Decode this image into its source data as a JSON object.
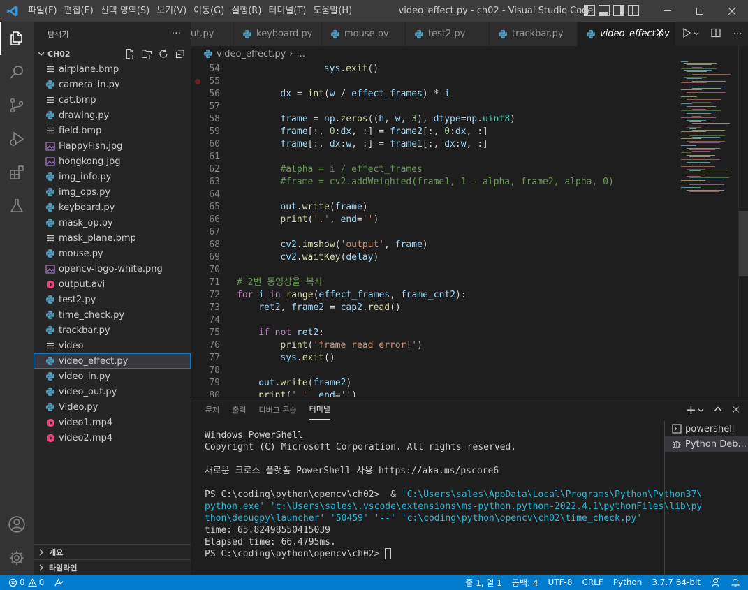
{
  "titlebar": {
    "menus": [
      "파일(F)",
      "편집(E)",
      "선택 영역(S)",
      "보기(V)",
      "이동(G)",
      "실행(R)",
      "터미널(T)",
      "도움말(H)"
    ],
    "window_title": "video_effect.py - ch02 - Visual Studio Code"
  },
  "sidebar": {
    "header": "탐색기",
    "folder": "CH02",
    "files": [
      {
        "name": "airplane.bmp",
        "icon": "lines-icon"
      },
      {
        "name": "camera_in.py",
        "icon": "python-icon"
      },
      {
        "name": "cat.bmp",
        "icon": "lines-icon"
      },
      {
        "name": "drawing.py",
        "icon": "python-icon"
      },
      {
        "name": "field.bmp",
        "icon": "lines-icon"
      },
      {
        "name": "HappyFish.jpg",
        "icon": "image-icon"
      },
      {
        "name": "hongkong.jpg",
        "icon": "image-icon"
      },
      {
        "name": "img_info.py",
        "icon": "python-icon"
      },
      {
        "name": "img_ops.py",
        "icon": "python-icon"
      },
      {
        "name": "keyboard.py",
        "icon": "python-icon"
      },
      {
        "name": "mask_op.py",
        "icon": "python-icon"
      },
      {
        "name": "mask_plane.bmp",
        "icon": "lines-icon"
      },
      {
        "name": "mouse.py",
        "icon": "python-icon"
      },
      {
        "name": "opencv-logo-white.png",
        "icon": "image-icon"
      },
      {
        "name": "output.avi",
        "icon": "video-icon"
      },
      {
        "name": "test2.py",
        "icon": "python-icon"
      },
      {
        "name": "time_check.py",
        "icon": "python-icon"
      },
      {
        "name": "trackbar.py",
        "icon": "python-icon"
      },
      {
        "name": "video",
        "icon": "lines-icon"
      },
      {
        "name": "video_effect.py",
        "icon": "python-icon"
      },
      {
        "name": "video_in.py",
        "icon": "python-icon"
      },
      {
        "name": "video_out.py",
        "icon": "python-icon"
      },
      {
        "name": "Video.py",
        "icon": "python-icon"
      },
      {
        "name": "video1.mp4",
        "icon": "video-icon"
      },
      {
        "name": "video2.mp4",
        "icon": "video-icon"
      }
    ],
    "outline_label": "개요",
    "timeline_label": "타임라인"
  },
  "tabs": [
    {
      "label": "ut.py"
    },
    {
      "label": "keyboard.py"
    },
    {
      "label": "mouse.py"
    },
    {
      "label": "test2.py"
    },
    {
      "label": "trackbar.py"
    },
    {
      "label": "video_effect.py"
    }
  ],
  "breadcrumb": {
    "file": "video_effect.py",
    "rest": "..."
  },
  "editor": {
    "lines": [
      {
        "n": "54",
        "indent": 16,
        "text": "sys.exit()"
      },
      {
        "n": "55",
        "indent": 0,
        "text": ""
      },
      {
        "n": "56",
        "indent": 8,
        "text": "dx = int(w / effect_frames) * i"
      },
      {
        "n": "57",
        "indent": 0,
        "text": ""
      },
      {
        "n": "58",
        "indent": 8,
        "text": "frame = np.zeros((h, w, 3), dtype=np.uint8)"
      },
      {
        "n": "59",
        "indent": 8,
        "text": "frame[:, 0:dx, :] = frame2[:, 0:dx, :]"
      },
      {
        "n": "60",
        "indent": 8,
        "text": "frame[:, dx:w, :] = frame1[:, dx:w, :]"
      },
      {
        "n": "61",
        "indent": 0,
        "text": ""
      },
      {
        "n": "62",
        "indent": 8,
        "text": "#alpha = i / effect_frames"
      },
      {
        "n": "63",
        "indent": 8,
        "text": "#frame = cv2.addWeighted(frame1, 1 - alpha, frame2, alpha, 0)"
      },
      {
        "n": "64",
        "indent": 0,
        "text": ""
      },
      {
        "n": "65",
        "indent": 8,
        "text": "out.write(frame)"
      },
      {
        "n": "66",
        "indent": 8,
        "text": "print('.', end='')"
      },
      {
        "n": "67",
        "indent": 0,
        "text": ""
      },
      {
        "n": "68",
        "indent": 8,
        "text": "cv2.imshow('output', frame)"
      },
      {
        "n": "69",
        "indent": 8,
        "text": "cv2.waitKey(delay)"
      },
      {
        "n": "70",
        "indent": 0,
        "text": ""
      },
      {
        "n": "71",
        "indent": 0,
        "text": "# 2번 동영상을 복사"
      },
      {
        "n": "72",
        "indent": 0,
        "text": "for i in range(effect_frames, frame_cnt2):"
      },
      {
        "n": "73",
        "indent": 4,
        "text": "ret2, frame2 = cap2.read()"
      },
      {
        "n": "74",
        "indent": 0,
        "text": ""
      },
      {
        "n": "75",
        "indent": 4,
        "text": "if not ret2:"
      },
      {
        "n": "76",
        "indent": 8,
        "text": "print('frame read error!')"
      },
      {
        "n": "77",
        "indent": 8,
        "text": "sys.exit()"
      },
      {
        "n": "78",
        "indent": 0,
        "text": ""
      },
      {
        "n": "79",
        "indent": 4,
        "text": "out.write(frame2)"
      },
      {
        "n": "80",
        "indent": 4,
        "text": "print('.', end='')"
      }
    ]
  },
  "panel": {
    "tabs": [
      "문제",
      "출력",
      "디버그 콘솔",
      "터미널"
    ],
    "active_tab": "터미널",
    "terminal_lines": [
      {
        "text": "Windows PowerShell",
        "style": "normal"
      },
      {
        "text": "Copyright (C) Microsoft Corporation. All rights reserved.",
        "style": "normal"
      },
      {
        "text": "",
        "style": "normal"
      },
      {
        "text": "새로운 크로스 플랫폼 PowerShell 사용 https://aka.ms/pscore6",
        "style": "normal"
      },
      {
        "text": "",
        "style": "normal"
      },
      {
        "text": "PS C:\\coding\\python\\opencv\\ch02>  & ",
        "style": "prompt",
        "cont": "'C:\\Users\\sales\\AppData\\Local\\Programs\\Python\\Python37\\"
      },
      {
        "text": "python.exe' 'c:\\Users\\sales\\.vscode\\extensions\\ms-python.python-2022.4.1\\pythonFiles\\lib\\py",
        "style": "cyan"
      },
      {
        "text": "thon\\debugpy\\launcher' '50459' '--' 'c:\\coding\\python\\opencv\\ch02\\time_check.py'",
        "style": "cyan"
      },
      {
        "text": "time: 65.82498550415039",
        "style": "normal"
      },
      {
        "text": "Elapsed time: 66.4795ms.",
        "style": "normal"
      },
      {
        "text": "PS C:\\coding\\python\\opencv\\ch02> ",
        "style": "cursor"
      }
    ],
    "terminal_list": [
      {
        "label": "powershell",
        "icon": "terminal-icon"
      },
      {
        "label": "Python Deb...",
        "icon": "debug-icon"
      }
    ]
  },
  "statusbar": {
    "errors": "0",
    "warnings": "0",
    "position": "줄 1, 열 1",
    "spaces": "공백: 4",
    "encoding": "UTF-8",
    "eol": "CRLF",
    "language": "Python",
    "interpreter": "3.7.7 64-bit"
  },
  "colors": {
    "accent": "#007acc",
    "python_icon": "#519aba",
    "image_icon": "#a074c4",
    "video_icon": "#e8467c",
    "vscode_blue": "#3c99d4"
  }
}
